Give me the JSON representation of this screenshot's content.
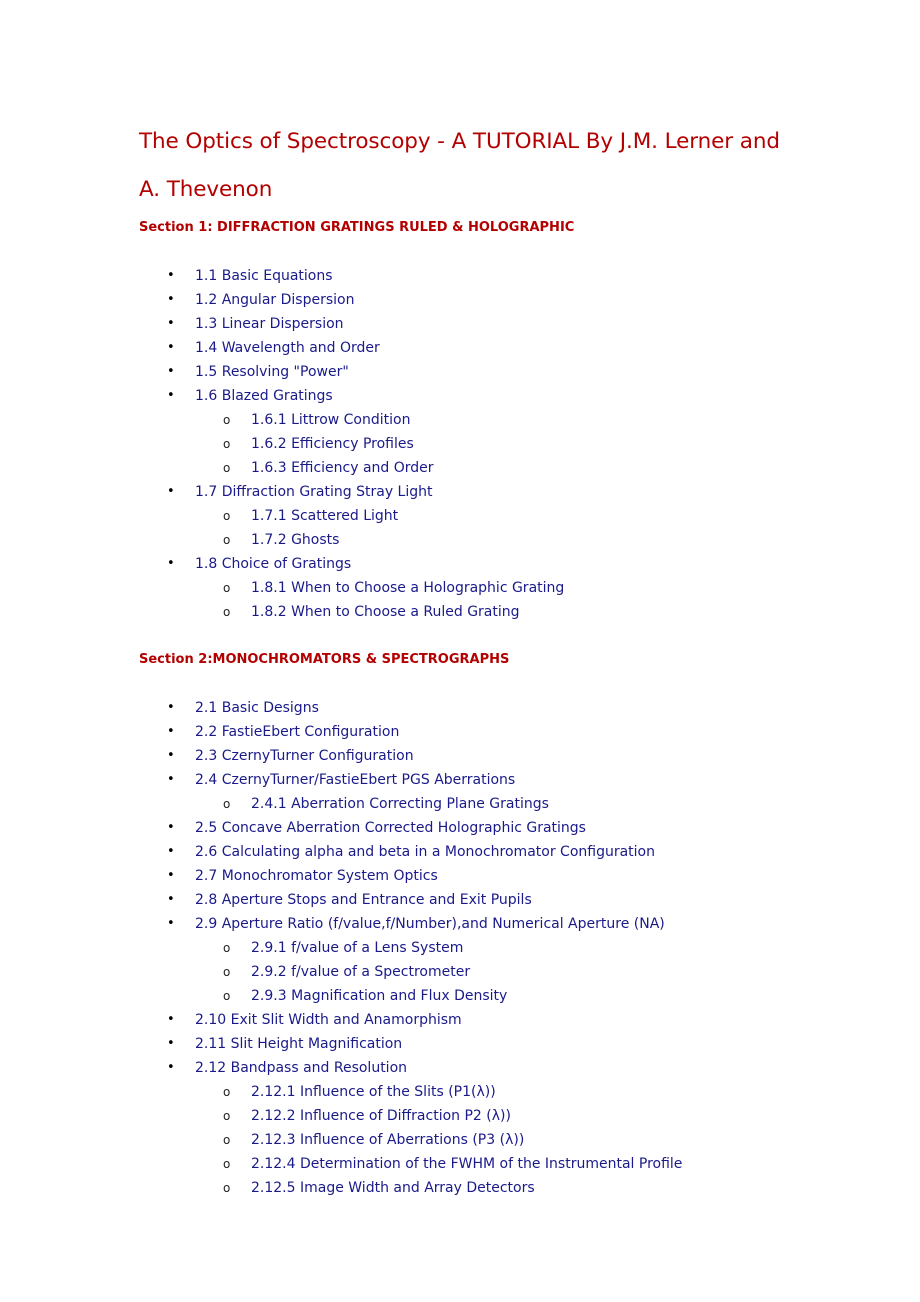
{
  "document": {
    "title_line1": "The Optics of Spectroscopy - A TUTORIAL By J.M. Lerner and",
    "title_line2": "A. Thevenon",
    "sections": [
      {
        "heading": "Section 1: DIFFRACTION GRATINGS  RULED & HOLOGRAPHIC",
        "items": [
          {
            "label": "1.1 Basic Equations",
            "level": 1
          },
          {
            "label": "1.2 Angular Dispersion",
            "level": 1
          },
          {
            "label": "1.3 Linear Dispersion",
            "level": 1
          },
          {
            "label": "1.4 Wavelength and Order",
            "level": 1
          },
          {
            "label": "1.5 Resolving \"Power\"",
            "level": 1
          },
          {
            "label": "1.6 Blazed Gratings",
            "level": 1
          },
          {
            "label": "1.6.1 Littrow Condition",
            "level": 2
          },
          {
            "label": "1.6.2 Efficiency Profiles",
            "level": 2
          },
          {
            "label": "1.6.3 Efficiency and Order",
            "level": 2
          },
          {
            "label": "1.7 Diffraction Grating Stray Light",
            "level": 1
          },
          {
            "label": "1.7.1 Scattered Light",
            "level": 2
          },
          {
            "label": "1.7.2 Ghosts",
            "level": 2
          },
          {
            "label": "1.8 Choice of Gratings",
            "level": 1
          },
          {
            "label": "1.8.1 When to Choose a Holographic Grating",
            "level": 2
          },
          {
            "label": "1.8.2 When to Choose a Ruled Grating",
            "level": 2
          }
        ]
      },
      {
        "heading": "Section 2:MONOCHROMATORS & SPECTROGRAPHS",
        "items": [
          {
            "label": "2.1 Basic Designs",
            "level": 1
          },
          {
            "label": "2.2 FastieEbert Configuration",
            "level": 1
          },
          {
            "label": "2.3 CzernyTurner Configuration",
            "level": 1
          },
          {
            "label": "2.4 CzernyTurner/FastieEbert PGS Aberrations",
            "level": 1
          },
          {
            "label": "2.4.1 Aberration Correcting Plane Gratings",
            "level": 2
          },
          {
            "label": "2.5 Concave Aberration Corrected Holographic Gratings",
            "level": 1
          },
          {
            "label": "2.6 Calculating alpha and beta in a Monochromator Configuration",
            "level": 1
          },
          {
            "label": "2.7 Monochromator System Optics",
            "level": 1
          },
          {
            "label": "2.8 Aperture Stops and Entrance and Exit Pupils",
            "level": 1
          },
          {
            "label": "2.9 Aperture Ratio (f/value,f/Number),and Numerical Aperture (NA)",
            "level": 1
          },
          {
            "label": "2.9.1 f/value of a Lens System",
            "level": 2
          },
          {
            "label": "2.9.2 f/value of a Spectrometer",
            "level": 2
          },
          {
            "label": "2.9.3 Magnification and Flux Density",
            "level": 2
          },
          {
            "label": "2.10 Exit Slit Width and Anamorphism",
            "level": 1
          },
          {
            "label": "2.11 Slit Height Magnification",
            "level": 1
          },
          {
            "label": "2.12 Bandpass and Resolution",
            "level": 1
          },
          {
            "label": "2.12.1 Influence of the Slits (P1(λ))",
            "level": 2
          },
          {
            "label": "2.12.2 Influence of Diffraction P2 (λ))",
            "level": 2
          },
          {
            "label": "2.12.3 Influence of Aberrations (P3 (λ))",
            "level": 2
          },
          {
            "label": "2.12.4 Determination of the FWHM of the Instrumental Profile",
            "level": 2
          },
          {
            "label": "2.12.5 Image Width and Array Detectors",
            "level": 2
          }
        ]
      }
    ],
    "bullet_level1": "•",
    "bullet_level2": "o"
  }
}
